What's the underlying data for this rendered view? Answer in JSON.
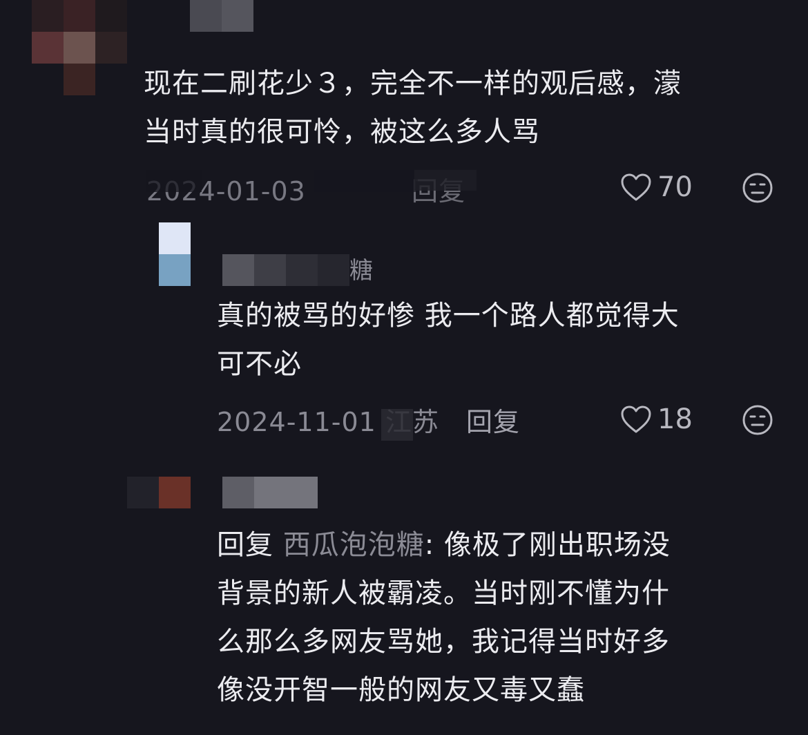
{
  "colors": {
    "background": "#16161e",
    "text": "#ececf0",
    "meta": "#8a8a94",
    "mention": "#8b8b95"
  },
  "comments": [
    {
      "text": "现在二刷花少３，完全不一样的观后感，濛\n当时真的很可怜，被这么多人骂",
      "date": "2024-01-03",
      "location": "",
      "reply_label": "回复",
      "likes": "70"
    },
    {
      "author_suffix": "糖",
      "text": "真的被骂的好惨 我一个路人都觉得大\n可不必",
      "date": "2024-11-01",
      "location": "江苏",
      "reply_label": "回复",
      "likes": "18"
    },
    {
      "reply_prefix": "回复",
      "mention": "西瓜泡泡糖",
      "text": ": 像极了刚出职场没\n背景的新人被霸凌。当时刚不懂为什\n么那么多网友骂她，我记得当时好多\n像没开智一般的网友又毒又蠢"
    }
  ],
  "icons": {
    "like": "heart-icon",
    "dislike": "meh-face-icon"
  }
}
